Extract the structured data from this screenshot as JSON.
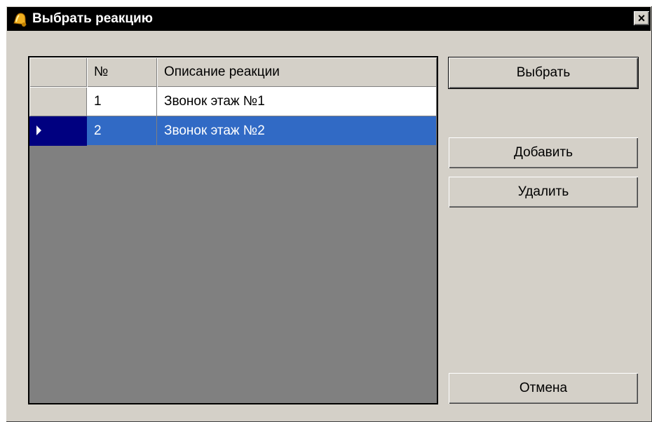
{
  "window": {
    "title": "Выбрать реакцию",
    "close_label": "×",
    "title_icon": "bell-icon"
  },
  "grid": {
    "columns": [
      "",
      "№",
      "Описание реакции"
    ],
    "rows": [
      {
        "num": "1",
        "description": "Звонок этаж №1",
        "selected": false
      },
      {
        "num": "2",
        "description": "Звонок этаж №2",
        "selected": true
      }
    ]
  },
  "buttons": {
    "choose": "Выбрать",
    "add": "Добавить",
    "delete": "Удалить",
    "cancel": "Отмена"
  },
  "colors": {
    "selection": "#316ac5",
    "indicator": "#000080",
    "face": "#d4d0c8",
    "grid_bg": "#808080"
  }
}
